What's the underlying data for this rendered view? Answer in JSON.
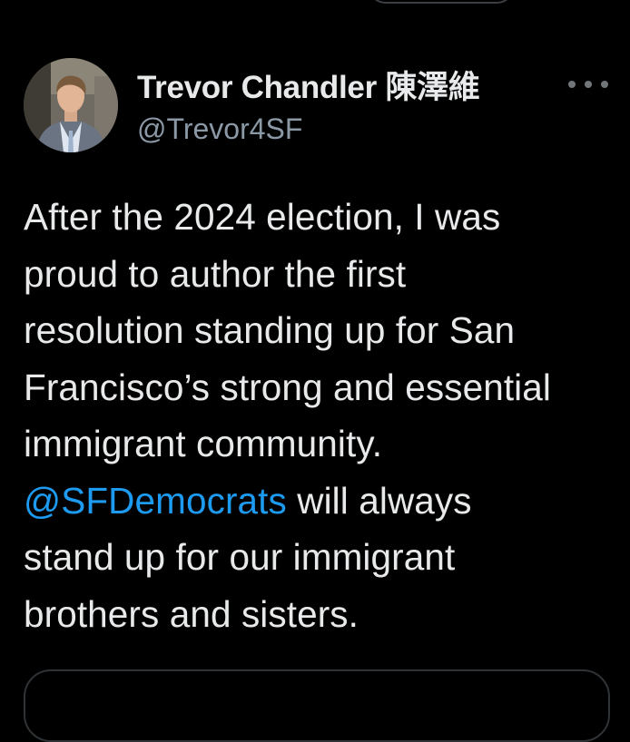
{
  "tweet": {
    "author": {
      "display_name": "Trevor Chandler 陳澤維",
      "handle": "@Trevor4SF",
      "avatar_icon": "profile-photo"
    },
    "more_icon": "more-horizontal-icon",
    "text_lines": [
      {
        "text": "After the 2024 election, I was"
      },
      {
        "text": "proud to author the first"
      },
      {
        "text": "resolution standing up for San"
      },
      {
        "text": "Francisco’s strong and essential"
      },
      {
        "text": "immigrant community."
      },
      {
        "mention": "@SFDemocrats",
        "text": " will always"
      },
      {
        "text": "stand up for our immigrant"
      },
      {
        "text": "brothers and sisters."
      }
    ]
  },
  "colors": {
    "background": "#000000",
    "primary_text": "#e7e9ea",
    "secondary_text": "#8b98a5",
    "mention": "#1d9bf0",
    "border": "#2f3336"
  }
}
